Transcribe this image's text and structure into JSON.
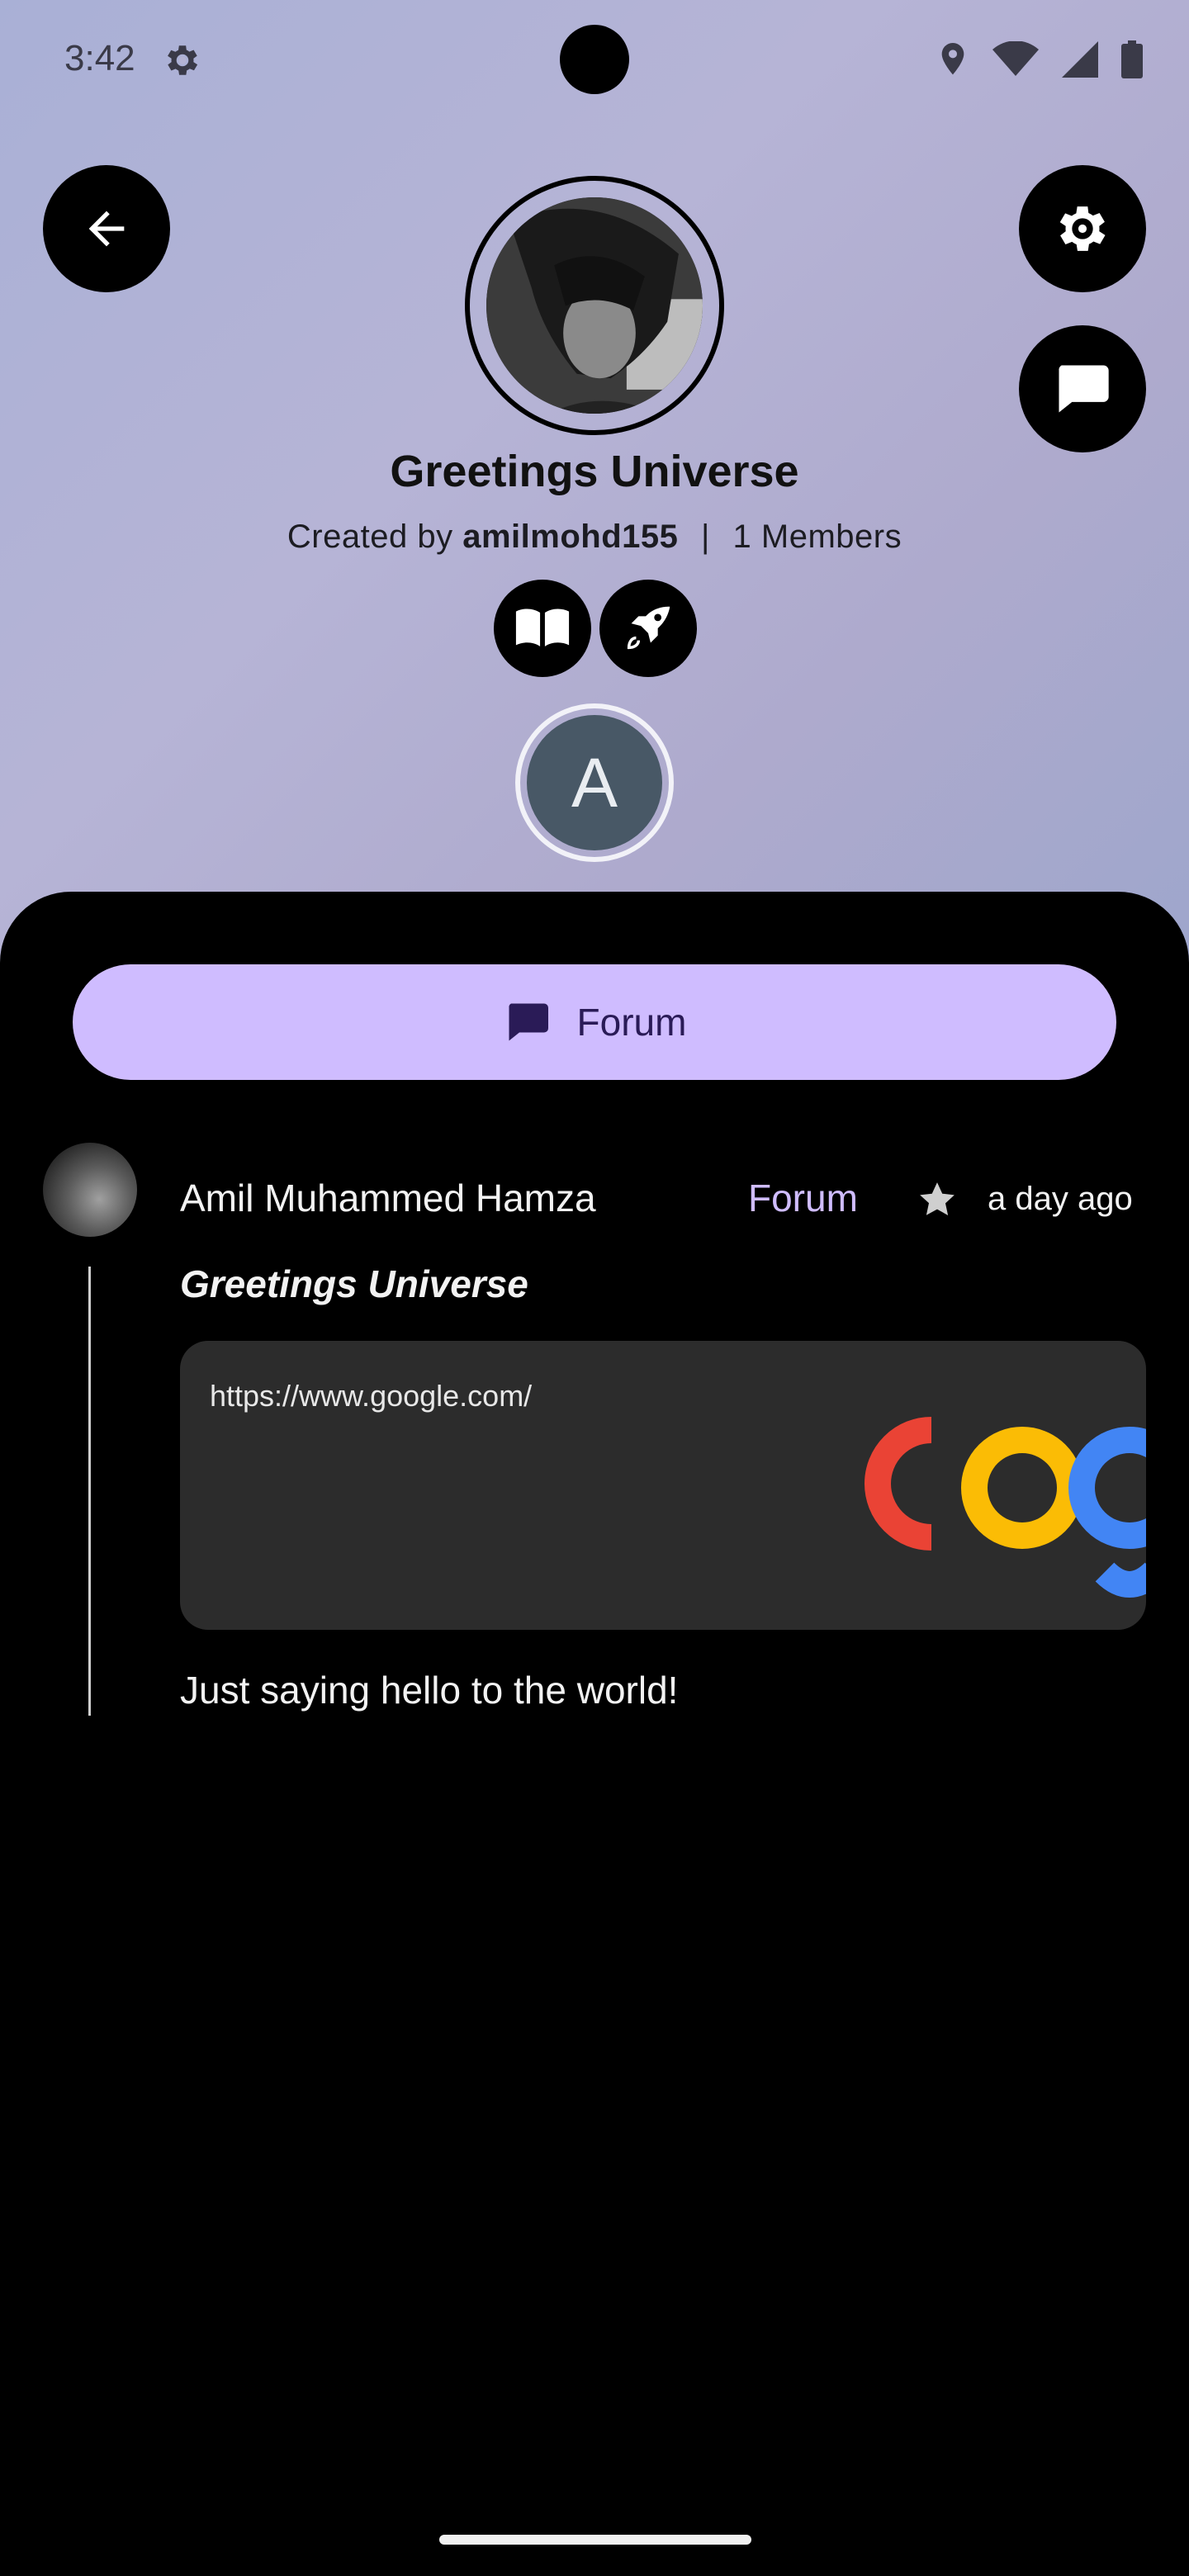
{
  "status_bar": {
    "time": "3:42"
  },
  "header": {
    "title": "Greetings Universe",
    "created_by_prefix": "Created by",
    "creator": "amilmohd155",
    "separator": "|",
    "members": "1 Members",
    "member_initial": "A",
    "badges": [
      "book-icon",
      "rocket-icon"
    ]
  },
  "actions": {
    "back": "arrow-left-icon",
    "settings": "gear-icon",
    "chat": "chat-bubble-icon"
  },
  "tabs": {
    "forum_label": "Forum"
  },
  "post": {
    "author": "Amil Muhammed Hamza",
    "community": "Forum",
    "time": "a day ago",
    "title": "Greetings Universe",
    "link_url": "https://www.google.com/",
    "body": "Just saying hello to the world!"
  },
  "colors": {
    "accent": "#cfbcff",
    "sheet_bg": "#000000",
    "card_bg": "#2c2c2c",
    "member_avatar": "#485866"
  }
}
